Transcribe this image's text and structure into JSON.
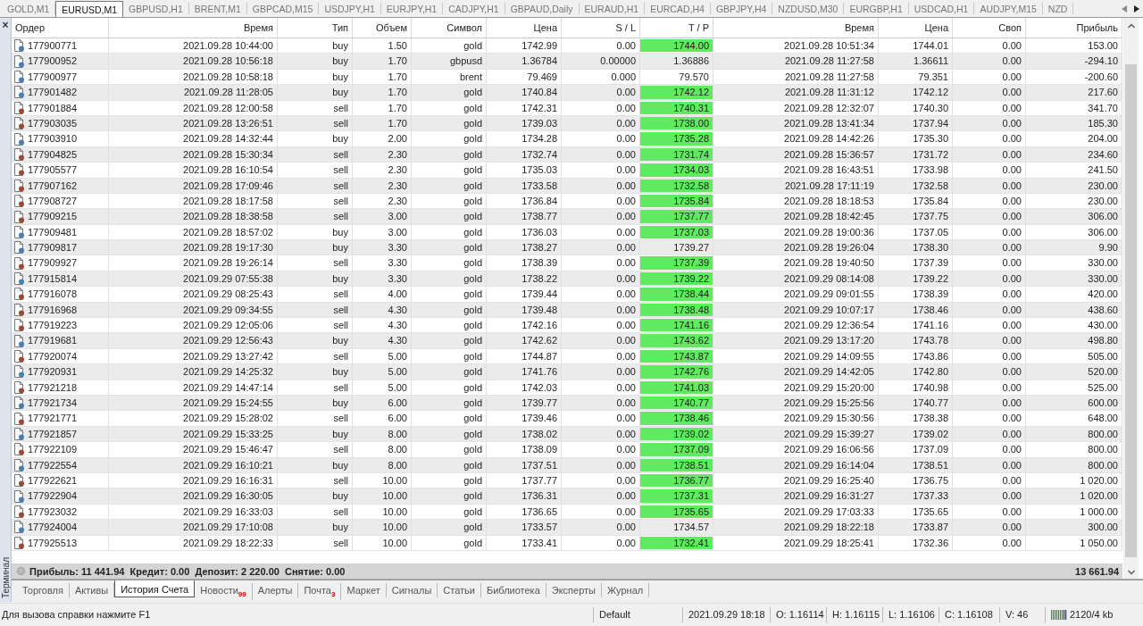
{
  "chart_tabs": [
    {
      "label": "GOLD,M1",
      "selected": false
    },
    {
      "label": "EURUSD,M1",
      "selected": true
    },
    {
      "label": "GBPUSD,H1",
      "selected": false
    },
    {
      "label": "BRENT,M1",
      "selected": false
    },
    {
      "label": "GBPCAD,M15",
      "selected": false
    },
    {
      "label": "USDJPY,H1",
      "selected": false
    },
    {
      "label": "EURJPY,H1",
      "selected": false
    },
    {
      "label": "CADJPY,H1",
      "selected": false
    },
    {
      "label": "GBPAUD,Daily",
      "selected": false
    },
    {
      "label": "EURAUD,H1",
      "selected": false
    },
    {
      "label": "EURCAD,H4",
      "selected": false
    },
    {
      "label": "GBPJPY,H4",
      "selected": false
    },
    {
      "label": "NZDUSD,M30",
      "selected": false
    },
    {
      "label": "EURGBP,H1",
      "selected": false
    },
    {
      "label": "USDCAD,H1",
      "selected": false
    },
    {
      "label": "AUDJPY,M15",
      "selected": false
    },
    {
      "label": "NZD",
      "selected": false
    }
  ],
  "panel": {
    "close": "×",
    "title": "Терминал"
  },
  "table": {
    "columns": [
      "Ордер",
      "Время",
      "Тип",
      "Объем",
      "Символ",
      "Цена",
      "S / L",
      "T / P",
      "Время",
      "Цена",
      "Своп",
      "Прибыль"
    ],
    "rows": [
      {
        "kind": "buy",
        "order": "177900771",
        "open_time": "2021.09.28 10:44:00",
        "type": "buy",
        "volume": "1.50",
        "symbol": "gold",
        "open_price": "1742.99",
        "sl": "0.00",
        "tp": "1744.00",
        "tp_hit": true,
        "close_time": "2021.09.28 10:51:34",
        "close_price": "1744.01",
        "swap": "0.00",
        "profit": "153.00"
      },
      {
        "kind": "buy",
        "order": "177900952",
        "open_time": "2021.09.28 10:56:18",
        "type": "buy",
        "volume": "1.70",
        "symbol": "gbpusd",
        "open_price": "1.36784",
        "sl": "0.00000",
        "tp": "1.36886",
        "tp_hit": false,
        "close_time": "2021.09.28 11:27:58",
        "close_price": "1.36611",
        "swap": "0.00",
        "profit": "-294.10"
      },
      {
        "kind": "buy",
        "order": "177900977",
        "open_time": "2021.09.28 10:58:18",
        "type": "buy",
        "volume": "1.70",
        "symbol": "brent",
        "open_price": "79.469",
        "sl": "0.000",
        "tp": "79.570",
        "tp_hit": false,
        "close_time": "2021.09.28 11:27:58",
        "close_price": "79.351",
        "swap": "0.00",
        "profit": "-200.60"
      },
      {
        "kind": "buy",
        "order": "177901482",
        "open_time": "2021.09.28 11:28:05",
        "type": "buy",
        "volume": "1.70",
        "symbol": "gold",
        "open_price": "1740.84",
        "sl": "0.00",
        "tp": "1742.12",
        "tp_hit": true,
        "close_time": "2021.09.28 11:31:12",
        "close_price": "1742.12",
        "swap": "0.00",
        "profit": "217.60"
      },
      {
        "kind": "sell",
        "order": "177901884",
        "open_time": "2021.09.28 12:00:58",
        "type": "sell",
        "volume": "1.70",
        "symbol": "gold",
        "open_price": "1742.31",
        "sl": "0.00",
        "tp": "1740.31",
        "tp_hit": true,
        "close_time": "2021.09.28 12:32:07",
        "close_price": "1740.30",
        "swap": "0.00",
        "profit": "341.70"
      },
      {
        "kind": "sell",
        "order": "177903035",
        "open_time": "2021.09.28 13:26:51",
        "type": "sell",
        "volume": "1.70",
        "symbol": "gold",
        "open_price": "1739.03",
        "sl": "0.00",
        "tp": "1738.00",
        "tp_hit": true,
        "close_time": "2021.09.28 13:41:34",
        "close_price": "1737.94",
        "swap": "0.00",
        "profit": "185.30"
      },
      {
        "kind": "buy",
        "order": "177903910",
        "open_time": "2021.09.28 14:32:44",
        "type": "buy",
        "volume": "2.00",
        "symbol": "gold",
        "open_price": "1734.28",
        "sl": "0.00",
        "tp": "1735.28",
        "tp_hit": true,
        "close_time": "2021.09.28 14:42:26",
        "close_price": "1735.30",
        "swap": "0.00",
        "profit": "204.00"
      },
      {
        "kind": "sell",
        "order": "177904825",
        "open_time": "2021.09.28 15:30:34",
        "type": "sell",
        "volume": "2.30",
        "symbol": "gold",
        "open_price": "1732.74",
        "sl": "0.00",
        "tp": "1731.74",
        "tp_hit": true,
        "close_time": "2021.09.28 15:36:57",
        "close_price": "1731.72",
        "swap": "0.00",
        "profit": "234.60"
      },
      {
        "kind": "sell",
        "order": "177905577",
        "open_time": "2021.09.28 16:10:54",
        "type": "sell",
        "volume": "2.30",
        "symbol": "gold",
        "open_price": "1735.03",
        "sl": "0.00",
        "tp": "1734.03",
        "tp_hit": true,
        "close_time": "2021.09.28 16:43:51",
        "close_price": "1733.98",
        "swap": "0.00",
        "profit": "241.50"
      },
      {
        "kind": "sell",
        "order": "177907162",
        "open_time": "2021.09.28 17:09:46",
        "type": "sell",
        "volume": "2.30",
        "symbol": "gold",
        "open_price": "1733.58",
        "sl": "0.00",
        "tp": "1732.58",
        "tp_hit": true,
        "close_time": "2021.09.28 17:11:19",
        "close_price": "1732.58",
        "swap": "0.00",
        "profit": "230.00"
      },
      {
        "kind": "sell",
        "order": "177908727",
        "open_time": "2021.09.28 18:17:58",
        "type": "sell",
        "volume": "2.30",
        "symbol": "gold",
        "open_price": "1736.84",
        "sl": "0.00",
        "tp": "1735.84",
        "tp_hit": true,
        "close_time": "2021.09.28 18:18:53",
        "close_price": "1735.84",
        "swap": "0.00",
        "profit": "230.00"
      },
      {
        "kind": "sell",
        "order": "177909215",
        "open_time": "2021.09.28 18:38:58",
        "type": "sell",
        "volume": "3.00",
        "symbol": "gold",
        "open_price": "1738.77",
        "sl": "0.00",
        "tp": "1737.77",
        "tp_hit": true,
        "close_time": "2021.09.28 18:42:45",
        "close_price": "1737.75",
        "swap": "0.00",
        "profit": "306.00"
      },
      {
        "kind": "buy",
        "order": "177909481",
        "open_time": "2021.09.28 18:57:02",
        "type": "buy",
        "volume": "3.00",
        "symbol": "gold",
        "open_price": "1736.03",
        "sl": "0.00",
        "tp": "1737.03",
        "tp_hit": true,
        "close_time": "2021.09.28 19:00:36",
        "close_price": "1737.05",
        "swap": "0.00",
        "profit": "306.00"
      },
      {
        "kind": "buy",
        "order": "177909817",
        "open_time": "2021.09.28 19:17:30",
        "type": "buy",
        "volume": "3.30",
        "symbol": "gold",
        "open_price": "1738.27",
        "sl": "0.00",
        "tp": "1739.27",
        "tp_hit": false,
        "close_time": "2021.09.28 19:26:04",
        "close_price": "1738.30",
        "swap": "0.00",
        "profit": "9.90"
      },
      {
        "kind": "sell",
        "order": "177909927",
        "open_time": "2021.09.28 19:26:14",
        "type": "sell",
        "volume": "3.30",
        "symbol": "gold",
        "open_price": "1738.39",
        "sl": "0.00",
        "tp": "1737.39",
        "tp_hit": true,
        "close_time": "2021.09.28 19:40:50",
        "close_price": "1737.39",
        "swap": "0.00",
        "profit": "330.00"
      },
      {
        "kind": "buy",
        "order": "177915814",
        "open_time": "2021.09.29 07:55:38",
        "type": "buy",
        "volume": "3.30",
        "symbol": "gold",
        "open_price": "1738.22",
        "sl": "0.00",
        "tp": "1739.22",
        "tp_hit": true,
        "close_time": "2021.09.29 08:14:08",
        "close_price": "1739.22",
        "swap": "0.00",
        "profit": "330.00"
      },
      {
        "kind": "sell",
        "order": "177916078",
        "open_time": "2021.09.29 08:25:43",
        "type": "sell",
        "volume": "4.00",
        "symbol": "gold",
        "open_price": "1739.44",
        "sl": "0.00",
        "tp": "1738.44",
        "tp_hit": true,
        "close_time": "2021.09.29 09:01:55",
        "close_price": "1738.39",
        "swap": "0.00",
        "profit": "420.00"
      },
      {
        "kind": "sell",
        "order": "177916968",
        "open_time": "2021.09.29 09:34:55",
        "type": "sell",
        "volume": "4.30",
        "symbol": "gold",
        "open_price": "1739.48",
        "sl": "0.00",
        "tp": "1738.48",
        "tp_hit": true,
        "close_time": "2021.09.29 10:07:17",
        "close_price": "1738.46",
        "swap": "0.00",
        "profit": "438.60"
      },
      {
        "kind": "sell",
        "order": "177919223",
        "open_time": "2021.09.29 12:05:06",
        "type": "sell",
        "volume": "4.30",
        "symbol": "gold",
        "open_price": "1742.16",
        "sl": "0.00",
        "tp": "1741.16",
        "tp_hit": true,
        "close_time": "2021.09.29 12:36:54",
        "close_price": "1741.16",
        "swap": "0.00",
        "profit": "430.00"
      },
      {
        "kind": "buy",
        "order": "177919681",
        "open_time": "2021.09.29 12:56:43",
        "type": "buy",
        "volume": "4.30",
        "symbol": "gold",
        "open_price": "1742.62",
        "sl": "0.00",
        "tp": "1743.62",
        "tp_hit": true,
        "close_time": "2021.09.29 13:17:20",
        "close_price": "1743.78",
        "swap": "0.00",
        "profit": "498.80"
      },
      {
        "kind": "sell",
        "order": "177920074",
        "open_time": "2021.09.29 13:27:42",
        "type": "sell",
        "volume": "5.00",
        "symbol": "gold",
        "open_price": "1744.87",
        "sl": "0.00",
        "tp": "1743.87",
        "tp_hit": true,
        "close_time": "2021.09.29 14:09:55",
        "close_price": "1743.86",
        "swap": "0.00",
        "profit": "505.00"
      },
      {
        "kind": "buy",
        "order": "177920931",
        "open_time": "2021.09.29 14:25:32",
        "type": "buy",
        "volume": "5.00",
        "symbol": "gold",
        "open_price": "1741.76",
        "sl": "0.00",
        "tp": "1742.76",
        "tp_hit": true,
        "close_time": "2021.09.29 14:42:05",
        "close_price": "1742.80",
        "swap": "0.00",
        "profit": "520.00"
      },
      {
        "kind": "sell",
        "order": "177921218",
        "open_time": "2021.09.29 14:47:14",
        "type": "sell",
        "volume": "5.00",
        "symbol": "gold",
        "open_price": "1742.03",
        "sl": "0.00",
        "tp": "1741.03",
        "tp_hit": true,
        "close_time": "2021.09.29 15:20:00",
        "close_price": "1740.98",
        "swap": "0.00",
        "profit": "525.00"
      },
      {
        "kind": "buy",
        "order": "177921734",
        "open_time": "2021.09.29 15:24:55",
        "type": "buy",
        "volume": "6.00",
        "symbol": "gold",
        "open_price": "1739.77",
        "sl": "0.00",
        "tp": "1740.77",
        "tp_hit": true,
        "close_time": "2021.09.29 15:25:56",
        "close_price": "1740.77",
        "swap": "0.00",
        "profit": "600.00"
      },
      {
        "kind": "sell",
        "order": "177921771",
        "open_time": "2021.09.29 15:28:02",
        "type": "sell",
        "volume": "6.00",
        "symbol": "gold",
        "open_price": "1739.46",
        "sl": "0.00",
        "tp": "1738.46",
        "tp_hit": true,
        "close_time": "2021.09.29 15:30:56",
        "close_price": "1738.38",
        "swap": "0.00",
        "profit": "648.00"
      },
      {
        "kind": "buy",
        "order": "177921857",
        "open_time": "2021.09.29 15:33:25",
        "type": "buy",
        "volume": "8.00",
        "symbol": "gold",
        "open_price": "1738.02",
        "sl": "0.00",
        "tp": "1739.02",
        "tp_hit": true,
        "close_time": "2021.09.29 15:39:27",
        "close_price": "1739.02",
        "swap": "0.00",
        "profit": "800.00"
      },
      {
        "kind": "sell",
        "order": "177922109",
        "open_time": "2021.09.29 15:46:47",
        "type": "sell",
        "volume": "8.00",
        "symbol": "gold",
        "open_price": "1738.09",
        "sl": "0.00",
        "tp": "1737.09",
        "tp_hit": true,
        "close_time": "2021.09.29 16:06:56",
        "close_price": "1737.09",
        "swap": "0.00",
        "profit": "800.00"
      },
      {
        "kind": "buy",
        "order": "177922554",
        "open_time": "2021.09.29 16:10:21",
        "type": "buy",
        "volume": "8.00",
        "symbol": "gold",
        "open_price": "1737.51",
        "sl": "0.00",
        "tp": "1738.51",
        "tp_hit": true,
        "close_time": "2021.09.29 16:14:04",
        "close_price": "1738.51",
        "swap": "0.00",
        "profit": "800.00"
      },
      {
        "kind": "sell",
        "order": "177922621",
        "open_time": "2021.09.29 16:16:31",
        "type": "sell",
        "volume": "10.00",
        "symbol": "gold",
        "open_price": "1737.77",
        "sl": "0.00",
        "tp": "1736.77",
        "tp_hit": true,
        "close_time": "2021.09.29 16:25:40",
        "close_price": "1736.75",
        "swap": "0.00",
        "profit": "1 020.00"
      },
      {
        "kind": "buy",
        "order": "177922904",
        "open_time": "2021.09.29 16:30:05",
        "type": "buy",
        "volume": "10.00",
        "symbol": "gold",
        "open_price": "1736.31",
        "sl": "0.00",
        "tp": "1737.31",
        "tp_hit": true,
        "close_time": "2021.09.29 16:31:27",
        "close_price": "1737.33",
        "swap": "0.00",
        "profit": "1 020.00"
      },
      {
        "kind": "sell",
        "order": "177923032",
        "open_time": "2021.09.29 16:33:03",
        "type": "sell",
        "volume": "10.00",
        "symbol": "gold",
        "open_price": "1736.65",
        "sl": "0.00",
        "tp": "1735.65",
        "tp_hit": true,
        "close_time": "2021.09.29 17:03:33",
        "close_price": "1735.65",
        "swap": "0.00",
        "profit": "1 000.00"
      },
      {
        "kind": "buy",
        "order": "177924004",
        "open_time": "2021.09.29 17:10:08",
        "type": "buy",
        "volume": "10.00",
        "symbol": "gold",
        "open_price": "1733.57",
        "sl": "0.00",
        "tp": "1734.57",
        "tp_hit": false,
        "close_time": "2021.09.29 18:22:18",
        "close_price": "1733.87",
        "swap": "0.00",
        "profit": "300.00"
      },
      {
        "kind": "sell",
        "order": "177925513",
        "open_time": "2021.09.29 18:22:33",
        "type": "sell",
        "volume": "10.00",
        "symbol": "gold",
        "open_price": "1733.41",
        "sl": "0.00",
        "tp": "1732.41",
        "tp_hit": true,
        "close_time": "2021.09.29 18:25:41",
        "close_price": "1732.36",
        "swap": "0.00",
        "profit": "1 050.00"
      }
    ],
    "summary": {
      "text": "Прибыль: 11 441.94  Кредит: 0.00  Депозит: 2 220.00  Снятие: 0.00",
      "total": "13 661.94"
    }
  },
  "terminal_tabs": [
    {
      "label": "Торговля",
      "selected": false
    },
    {
      "label": "Активы",
      "selected": false
    },
    {
      "label": "История Счета",
      "selected": true
    },
    {
      "label": "Новости",
      "badge": "99",
      "selected": false
    },
    {
      "label": "Алерты",
      "selected": false
    },
    {
      "label": "Почта",
      "badge": "3",
      "selected": false
    },
    {
      "label": "Маркет",
      "selected": false
    },
    {
      "label": "Сигналы",
      "selected": false
    },
    {
      "label": "Статьи",
      "selected": false
    },
    {
      "label": "Библиотека",
      "selected": false
    },
    {
      "label": "Эксперты",
      "selected": false
    },
    {
      "label": "Журнал",
      "selected": false
    }
  ],
  "status_bar": {
    "help": "Для вызова справки нажмите F1",
    "profile": "Default",
    "time": "2021.09.29 18:18",
    "open": "O: 1.16114",
    "high": "H: 1.16115",
    "low": "L: 1.16106",
    "close": "C: 1.16108",
    "volume": "V: 46",
    "traffic": "2120/4 kb"
  }
}
